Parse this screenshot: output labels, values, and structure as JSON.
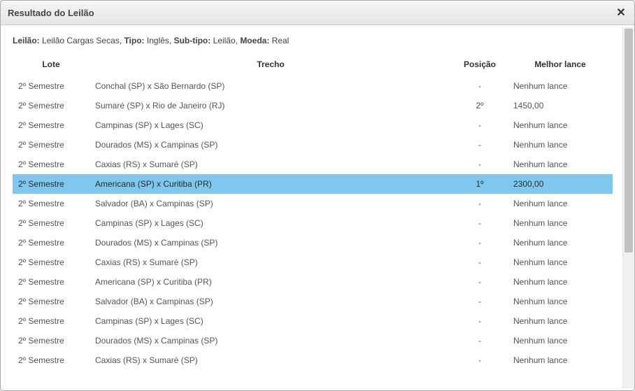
{
  "dialog": {
    "title": "Resultado do Leilão"
  },
  "info": {
    "label_leilao": "Leilão:",
    "leilao": "Leilão Cargas Secas,",
    "label_tipo": "Tipo:",
    "tipo": "Inglês,",
    "label_subtipo": "Sub-tipo:",
    "subtipo": "Leilão,",
    "label_moeda": "Moeda:",
    "moeda": "Real"
  },
  "columns": {
    "lote": "Lote",
    "trecho": "Trecho",
    "posicao": "Posição",
    "melhor_lance": "Melhor lance"
  },
  "rows": [
    {
      "lote": "2º Semestre",
      "trecho": "Conchal (SP) x São Bernardo (SP)",
      "posicao": "-",
      "lance": "Nenhum lance",
      "highlight": false
    },
    {
      "lote": "2º Semestre",
      "trecho": "Sumaré (SP) x Rio de Janeiro (RJ)",
      "posicao": "2º",
      "lance": "1450,00",
      "highlight": false
    },
    {
      "lote": "2º Semestre",
      "trecho": "Campinas (SP) x Lages (SC)",
      "posicao": "-",
      "lance": "Nenhum lance",
      "highlight": false
    },
    {
      "lote": "2º Semestre",
      "trecho": "Dourados (MS) x Campinas (SP)",
      "posicao": "-",
      "lance": "Nenhum lance",
      "highlight": false
    },
    {
      "lote": "2º Semestre",
      "trecho": "Caxias (RS) x Sumaré (SP)",
      "posicao": "-",
      "lance": "Nenhum lance",
      "highlight": false
    },
    {
      "lote": "2º Semestre",
      "trecho": "Americana (SP) x Curitiba (PR)",
      "posicao": "1º",
      "lance": "2300,00",
      "highlight": true
    },
    {
      "lote": "2º Semestre",
      "trecho": "Salvador (BA) x Campinas (SP)",
      "posicao": "-",
      "lance": "Nenhum lance",
      "highlight": false
    },
    {
      "lote": "2º Semestre",
      "trecho": "Campinas (SP) x Lages (SC)",
      "posicao": "-",
      "lance": "Nenhum lance",
      "highlight": false
    },
    {
      "lote": "2º Semestre",
      "trecho": "Dourados (MS) x Campinas (SP)",
      "posicao": "-",
      "lance": "Nenhum lance",
      "highlight": false
    },
    {
      "lote": "2º Semestre",
      "trecho": "Caxias (RS) x Sumaré (SP)",
      "posicao": "-",
      "lance": "Nenhum lance",
      "highlight": false
    },
    {
      "lote": "2º Semestre",
      "trecho": "Americana (SP) x Curitiba (PR)",
      "posicao": "-",
      "lance": "Nenhum lance",
      "highlight": false
    },
    {
      "lote": "2º Semestre",
      "trecho": "Salvador (BA) x Campinas (SP)",
      "posicao": "-",
      "lance": "Nenhum lance",
      "highlight": false
    },
    {
      "lote": "2º Semestre",
      "trecho": "Campinas (SP) x Lages (SC)",
      "posicao": "-",
      "lance": "Nenhum lance",
      "highlight": false
    },
    {
      "lote": "2º Semestre",
      "trecho": "Dourados (MS) x Campinas (SP)",
      "posicao": "-",
      "lance": "Nenhum lance",
      "highlight": false
    },
    {
      "lote": "2º Semestre",
      "trecho": "Caxias (RS) x Sumaré (SP)",
      "posicao": "-",
      "lance": "Nenhum lance",
      "highlight": false
    }
  ]
}
